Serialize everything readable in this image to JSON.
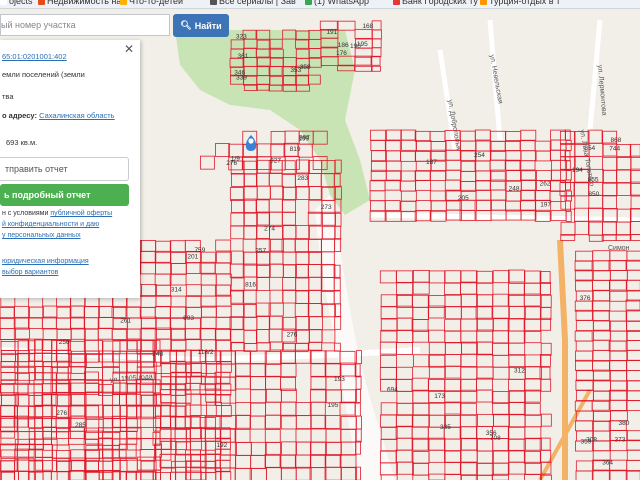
{
  "bookmarks": [
    {
      "label": "ojects",
      "icon": "blank-icon",
      "color": "#ffffff"
    },
    {
      "label": "Недвижимость на",
      "icon": "house-icon",
      "color": "#e64a19"
    },
    {
      "label": "Что-то-детеи",
      "icon": "page-icon",
      "color": "#ffb300"
    },
    {
      "label": "Все сериалы | Зав",
      "icon": "clock-icon",
      "color": "#555555"
    },
    {
      "label": "(1) WhatsApp",
      "icon": "whatsapp-icon",
      "color": "#34a853"
    },
    {
      "label": "Банк Городских ту",
      "icon": "bank-icon",
      "color": "#e53935"
    },
    {
      "label": "Турция-отдых в т",
      "icon": "travel-icon",
      "color": "#ff9800"
    }
  ],
  "search": {
    "placeholder": "ый номер участка",
    "button_label": "Найти"
  },
  "panel": {
    "cadastral_number": "65:01:0201001:402",
    "category_line1": "емли поселений (земли",
    "category_line2": "тва",
    "address_prefix": "о адресу:",
    "address_value": "Сахалинская область",
    "area": "693 кв.м.",
    "send_report_label": "тправить отчет",
    "detailed_report_label": "ь подробный отчет",
    "terms_line1_plain": "н с условиями",
    "terms_line1_link": "публичной оферты",
    "terms_line2": "й конфиденциальности и даю",
    "terms_line3": "у персональных данных",
    "legal_info": "юридическая информация",
    "options_link": "выбор вариантов"
  },
  "map": {
    "streets": [
      "ул. Невельская",
      "ул. Доброполья",
      "ул. Лермонтова",
      "ул. Льва Толстого",
      "ул. 1905 года",
      "Симон"
    ],
    "parcel_labels": [
      "256",
      "269",
      "276",
      "285",
      "261",
      "262",
      "759",
      "314",
      "118/2",
      "248",
      "201",
      "693",
      "257",
      "273",
      "276",
      "274",
      "283",
      "816",
      "819",
      "276",
      "927",
      "199",
      "397",
      "1/9",
      "262",
      "197",
      "205",
      "187",
      "248",
      "254",
      "173",
      "356",
      "312",
      "335",
      "694",
      "708",
      "744",
      "194",
      "850",
      "868",
      "855",
      "854",
      "373",
      "376",
      "380",
      "359",
      "364",
      "308",
      "361",
      "323",
      "353",
      "339",
      "346",
      "358",
      "186",
      "195",
      "168",
      "176",
      "190",
      "191",
      "192",
      "193",
      "195"
    ]
  },
  "colors": {
    "parcel_stroke": "#e0192b",
    "forest": "#c9e4b4",
    "road": "#ffffff",
    "major_road": "#f4b266",
    "button_primary": "#3d74b8",
    "button_report": "#4caf50",
    "marker": "#3b82d6"
  }
}
